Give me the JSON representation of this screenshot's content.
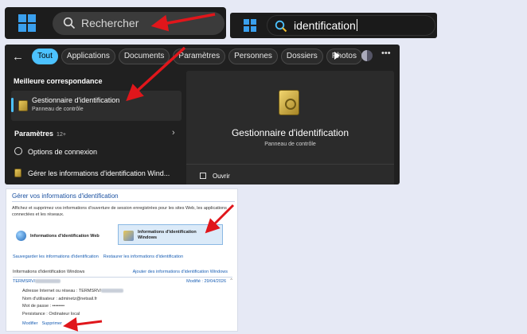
{
  "taskbar": {
    "search_placeholder": "Rechercher"
  },
  "typed_search": {
    "query": "identification"
  },
  "results": {
    "filters": [
      "Tout",
      "Applications",
      "Documents",
      "Paramètres",
      "Personnes",
      "Dossiers",
      "Photos"
    ],
    "best_match_title": "Meilleure correspondance",
    "best_match": {
      "name": "Gestionnaire d'identification",
      "subtitle": "Panneau de contrôle"
    },
    "settings_title": "Paramètres",
    "settings_count": "12+",
    "settings_items": [
      "Options de connexion",
      "Gérer les informations d'identification Wind..."
    ],
    "preview": {
      "title": "Gestionnaire d'identification",
      "subtitle": "Panneau de contrôle",
      "open_label": "Ouvrir"
    }
  },
  "control_panel": {
    "title": "Gérer vos informations d'identification",
    "description": "Affichez et supprimez vos informations d'ouverture de session enregistrées pour les sites Web, les applications connectées et les réseaux.",
    "web_credentials": "Informations d'identification Web",
    "windows_credentials": "Informations d'identification Windows",
    "backup_link": "Sauvegarder les informations d'identification",
    "restore_link": "Restaurer les informations d'identification",
    "list_header": "Informations d'identification Windows",
    "add_link": "Ajouter des informations d'identification Windows",
    "entry": {
      "name_prefix": "TERMSRV/",
      "modified": "Modifié : 29/04/2026",
      "address_label": "Adresse Internet ou réseau : TERMSRV/",
      "username": "Nom d'utilisateur : adminetz@netsail.fr",
      "password": "Mot de passe : ••••••••",
      "persistence": "Persistance : Ordinateur local"
    },
    "edit_link": "Modifier",
    "delete_link": "Supprimer"
  },
  "colors": {
    "accent": "#4cc2ff",
    "annotation": "#e0161b",
    "link": "#1a5fb4"
  }
}
